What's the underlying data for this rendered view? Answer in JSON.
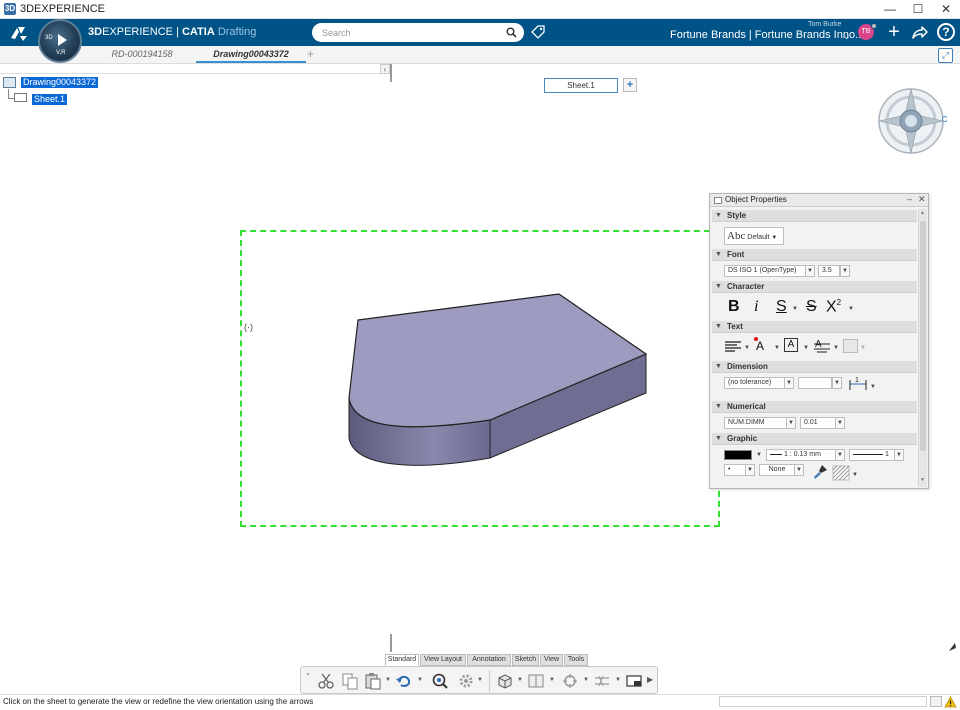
{
  "window": {
    "title": "3DEXPERIENCE",
    "minimize": "—",
    "maximize": "☐",
    "close": "✕"
  },
  "topbar": {
    "compass_3d_label": "3D",
    "compass_vr_label": "V,R",
    "brand_prefix": "3D",
    "brand_main": "EXPERIENCE",
    "brand_sep": " | ",
    "brand_product": "CATIA",
    "brand_app": "Drafting",
    "search_placeholder": "Search",
    "user_name": "Tom Burke",
    "tenant": "Fortune Brands | Fortune Brands Inno...",
    "avatar_initials": "TB",
    "colors": {
      "bar": "#005386",
      "avatar": "#d9458a"
    }
  },
  "tabs": [
    {
      "label": "RD-000194158",
      "active": false
    },
    {
      "label": "Drawing00043372",
      "active": true
    }
  ],
  "tab_add": "+",
  "tree": {
    "collapse": "‹",
    "root": "Drawing00043372",
    "child": "Sheet.1"
  },
  "sheet": {
    "tab_label": "Sheet.1",
    "add_label": "+",
    "frame_color": "#33e033",
    "part_top_color": "#9e9bbf",
    "part_side_color": "#6e6b8f"
  },
  "object_properties": {
    "title": "Object Properties",
    "minimize": "–",
    "close": "✕",
    "sections": {
      "style": "Style",
      "font": "Font",
      "character": "Character",
      "text": "Text",
      "dimension": "Dimension",
      "numerical": "Numerical",
      "graphic": "Graphic"
    },
    "style_icon": "Abc",
    "style_value": "Default",
    "font_name": "DS ISO 1 (OpenType)",
    "font_size": "3.5",
    "bold": "B",
    "italic": "i",
    "underline": "S",
    "strike": "S",
    "superscript": "X",
    "superscript_exp": "2",
    "tolerance": "(no tolerance)",
    "dim_value": "1",
    "numerical_format": "NUM.DIMM",
    "numerical_precision": "0.01",
    "line_weight_label": "1 : 0.13 mm",
    "line_type_label": "1",
    "point_label": "•",
    "fill_label": "None",
    "color_swatch": "#000000"
  },
  "workbench_tabs": [
    "Standard",
    "View Layout",
    "Annotation",
    "Sketch",
    "View",
    "Tools"
  ],
  "action_bar_icons": [
    "cut-icon",
    "copy-icon",
    "paste-icon",
    "undo-icon",
    "zoom-icon",
    "update-icon",
    "view-creation-icon",
    "section-view-icon",
    "detail-view-icon",
    "break-view-icon",
    "frame-icon"
  ],
  "status_text": "Click on the sheet to generate the view or redefine the view orientation using the arrows"
}
